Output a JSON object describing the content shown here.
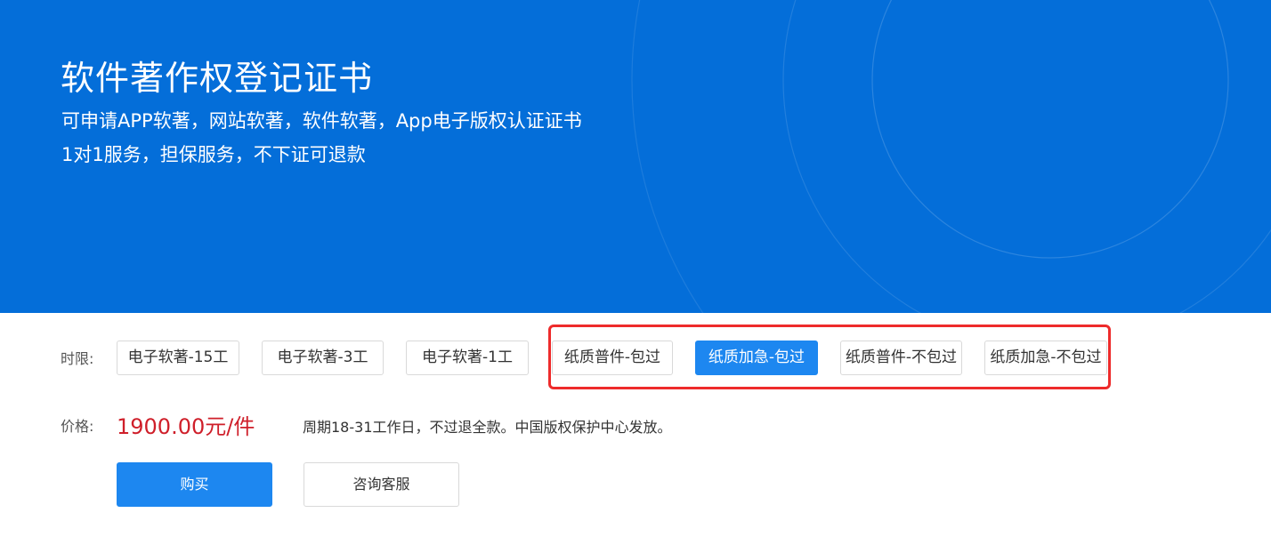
{
  "hero": {
    "title": "软件著作权登记证书",
    "subtitle_1": "可申请APP软著，网站软著，软件软著，App电子版权认证证书",
    "subtitle_2": "1对1服务，担保服务，不下证可退款"
  },
  "options": {
    "label": "时限:",
    "items": [
      {
        "label": "电子软著-15工"
      },
      {
        "label": "电子软著-3工"
      },
      {
        "label": "电子软著-1工"
      },
      {
        "label": "纸质普件-包过"
      },
      {
        "label": "纸质加急-包过",
        "selected": true
      },
      {
        "label": "纸质普件-不包过"
      },
      {
        "label": "纸质加急-不包过"
      }
    ]
  },
  "price": {
    "label": "价格:",
    "value": "1900.00元/件",
    "note": "周期18-31工作日，不过退全款。中国版权保护中心发放。"
  },
  "actions": {
    "buy_label": "购买",
    "consult_label": "咨询客服"
  },
  "colors": {
    "hero_bg": "#046ed9",
    "accent": "#1d87f0",
    "price": "#cf1f2a",
    "highlight_border": "#ee2b2b"
  }
}
